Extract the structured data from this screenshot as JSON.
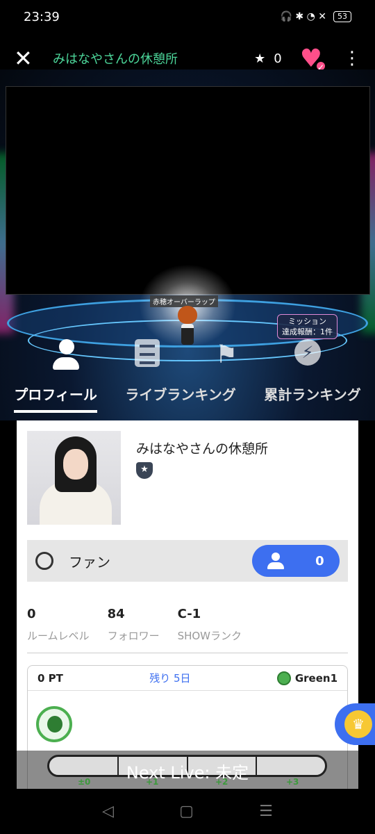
{
  "status": {
    "time": "23:39",
    "icons": "🎧 ✱ ◔ ✕",
    "battery": "53"
  },
  "header": {
    "title": "みはなやさんの休憩所",
    "star_count": "0"
  },
  "stage": {
    "avatar_name": "赤穂オーバーラップ",
    "mission_line1": "ミッション",
    "mission_line2": "達成報酬：1件"
  },
  "tabs": [
    "プロフィール",
    "ライブランキング",
    "累計ランキング"
  ],
  "profile": {
    "name": "みはなやさんの休憩所",
    "fan_label": "ファン",
    "fan_count": "0",
    "stats": [
      {
        "value": "0",
        "label": "ルームレベル"
      },
      {
        "value": "84",
        "label": "フォロワー"
      },
      {
        "value": "C-1",
        "label": "SHOWランク"
      }
    ],
    "points": "0 PT",
    "remaining": "残り 5日",
    "rank": "Green1"
  },
  "next_live": "Next Live: 未定",
  "scale_labels": [
    "±0",
    "+1",
    "+2",
    "+3"
  ],
  "nav": {
    "back": "◁",
    "home": "▢",
    "recent": "☰"
  },
  "colors": {
    "accent": "#3d6ff0",
    "title_green": "#4cd69a",
    "heart": "#ff4f8a"
  }
}
